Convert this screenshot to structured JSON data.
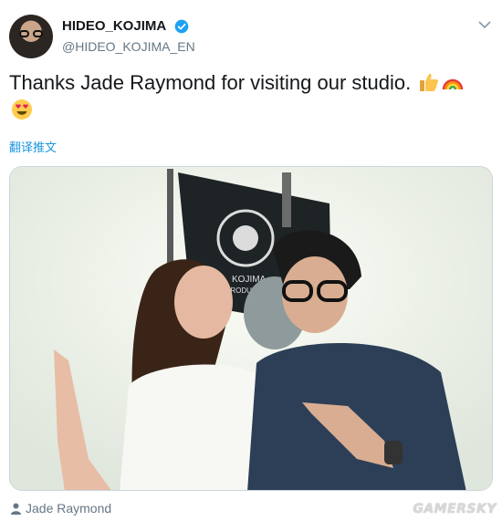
{
  "user": {
    "display_name": "HIDEO_KOJIMA",
    "handle": "@HIDEO_KOJIMA_EN",
    "verified": true
  },
  "tweet": {
    "text": "Thanks Jade Raymond for visiting our studio.",
    "emojis": [
      "thumbs-up",
      "rainbow",
      "heart-eyes"
    ]
  },
  "translate_label": "翻译推文",
  "photo": {
    "flag_text_line1": "KOJIMA",
    "flag_text_line2": "PRODUCTIONS"
  },
  "tagged_person": "Jade Raymond",
  "watermark": "GAMERSKY",
  "colors": {
    "link": "#1b95e0",
    "verified": "#1da1f2",
    "secondary_text": "#657786"
  }
}
